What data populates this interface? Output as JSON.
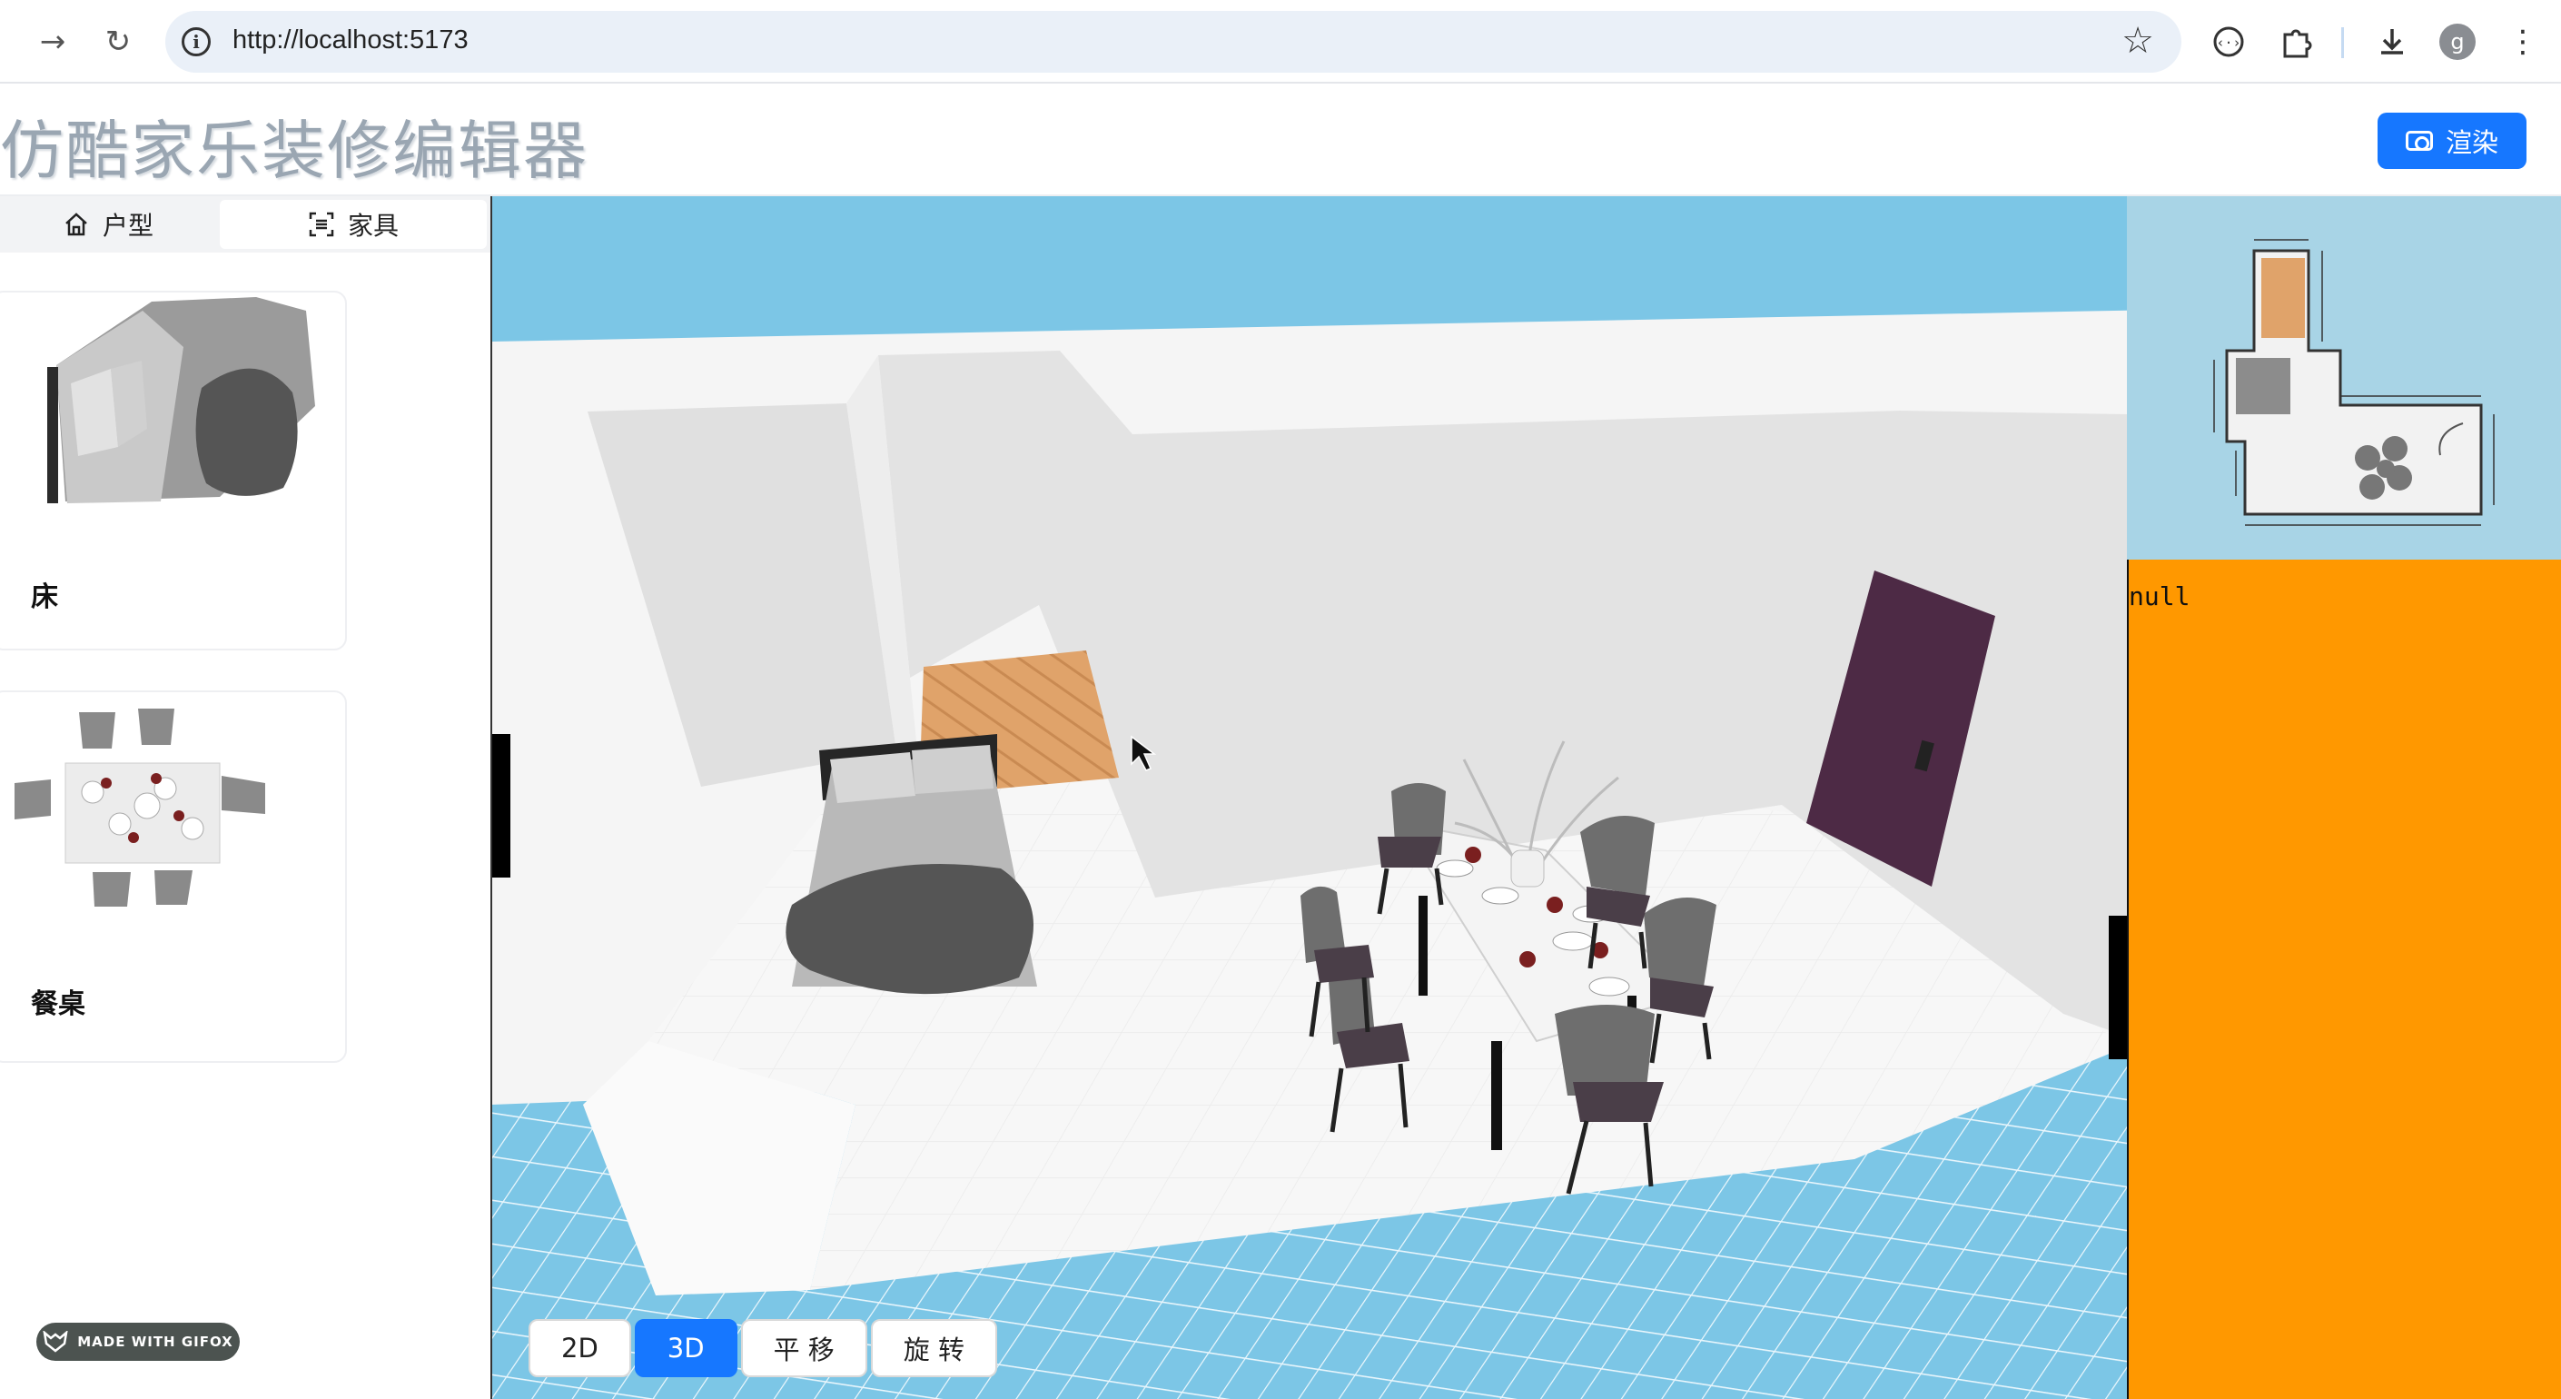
{
  "browser": {
    "url": "http://localhost:5173",
    "avatar_letter": "g"
  },
  "app": {
    "title": "仿酷家乐装修编辑器",
    "render_button": "渲染"
  },
  "tabs": [
    {
      "label": "户型",
      "icon": "home-icon",
      "active": false
    },
    {
      "label": "家具",
      "icon": "scan-icon",
      "active": true
    }
  ],
  "furniture": [
    {
      "label": "床",
      "icon": "bed-thumbnail"
    },
    {
      "label": "餐桌",
      "icon": "dining-table-thumbnail"
    }
  ],
  "view_modes": {
    "btn_2d": "2D",
    "btn_3d": "3D",
    "btn_pan": "平 移",
    "btn_rotate": "旋 转",
    "active": "3D"
  },
  "side_panel": {
    "debug_value": "null"
  },
  "watermark": "MADE WITH GIFOX",
  "colors": {
    "accent": "#1677ff",
    "sky": "#7cc6e6",
    "orange_panel": "#ff9800",
    "door": "#4d2a45",
    "rug": "#e0a36a"
  }
}
